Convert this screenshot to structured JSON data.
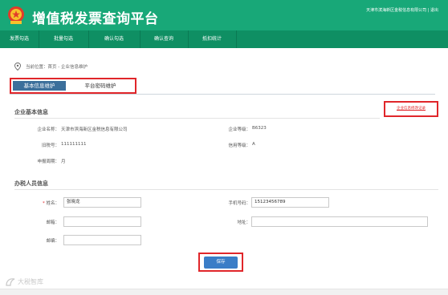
{
  "header": {
    "title": "增值税发票查询平台",
    "user_info": "天津市滨海新区金税信息有限公司 | 退出"
  },
  "nav": {
    "items": [
      "发票勾选",
      "批量勾选",
      "确认勾选",
      "确认查询",
      "抵扣统计"
    ]
  },
  "breadcrumb": {
    "text": "当前位置：首页 - 企业信息维护"
  },
  "tabs": {
    "active": "基本信息维护",
    "other": "平台密码维护"
  },
  "company": {
    "section_title": "企业基本信息",
    "record_link": "企业信息修改记录",
    "name_label": "企业名称：",
    "name_value": "天津市滨海新区金税信息有限公司",
    "rating_label": "企业等级：",
    "rating_value": "B6323",
    "old_tax_label": "旧税号：",
    "old_tax_value": "111111111",
    "credit_label": "信用等级：",
    "credit_value": "A",
    "period_label": "申报周期：",
    "period_value": "月"
  },
  "contact": {
    "section_title": "办税人员信息",
    "required_mark": "*",
    "name_label": "姓名：",
    "name_value": "张晓龙",
    "phone_label": "手机号码：",
    "phone_value": "15123456789",
    "email_label": "邮箱：",
    "email_value": "",
    "address_label": "地址：",
    "address_value": "",
    "postcode_label": "邮编：",
    "postcode_value": ""
  },
  "actions": {
    "save_label": "保存"
  },
  "watermark": {
    "text": "大税智库"
  },
  "colors": {
    "header_bg": "#18a878",
    "nav_bg": "#0f8f63",
    "tab_active_bg": "#3b6f9b",
    "highlight": "#e0262a",
    "save_button": "#3a7dc7"
  },
  "icons": [
    "emblem-logo-icon",
    "location-pin-icon",
    "watermark-logo-icon"
  ]
}
